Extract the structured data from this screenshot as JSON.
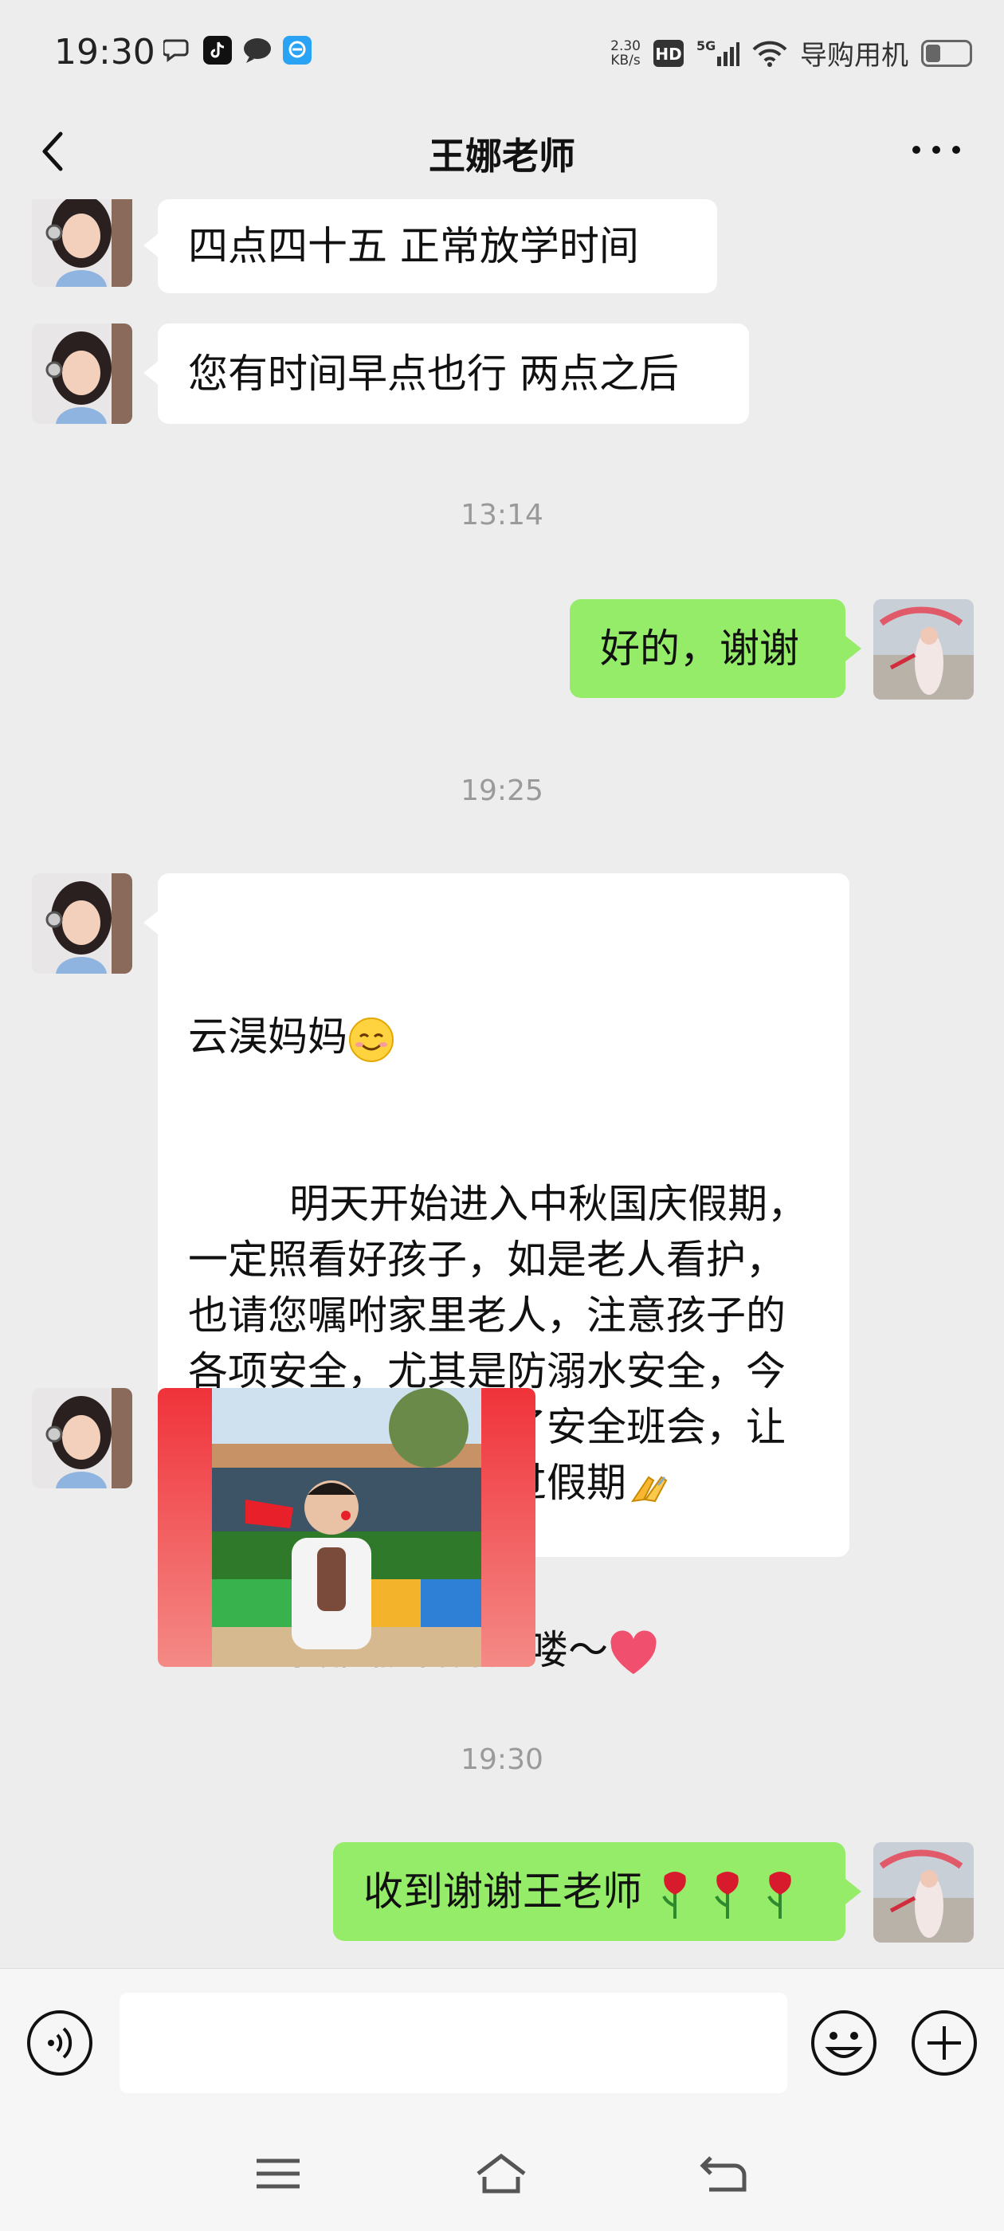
{
  "status_bar": {
    "time": "19:30",
    "net_speed_value": "2.30",
    "net_speed_unit": "KB/s",
    "hd": "HD",
    "network": "5G",
    "carrier": "导购用机",
    "battery_level": 0.35
  },
  "nav": {
    "title": "王娜老师",
    "back_icon": "chevron-left-icon",
    "more_icon": "more-dots-icon"
  },
  "messages": {
    "m1": "四点四十五  正常放学时间",
    "m2": "您有时间早点也行 两点之后",
    "ts1": "13:14",
    "m3": "好的，谢谢",
    "ts2": "19:25",
    "m4_line1": "云淏妈妈",
    "m4_body": "        明天开始进入中秋国庆假期，\n一定照看好孩子，如是老人看护，\n也请您嘱咐家里老人，注意孩子的\n各项安全，尤其是防溺水安全，今\n天我们在班里也开了安全班会，让\n孩子平平安安的度过假期",
    "m4_last": "        我们假后再见喽～",
    "ts3": "19:30",
    "m6": "收到谢谢王老师"
  },
  "input": {
    "voice_icon": "voice-icon",
    "emoji_icon": "emoji-icon",
    "plus_icon": "plus-icon",
    "value": ""
  },
  "system_nav": {
    "menu_icon": "menu-icon",
    "home_icon": "home-icon",
    "back_icon": "back-icon"
  },
  "colors": {
    "background": "#ededed",
    "outgoing_bubble": "#95ec69",
    "incoming_bubble": "#ffffff",
    "timestamp": "#9a9a9a"
  }
}
